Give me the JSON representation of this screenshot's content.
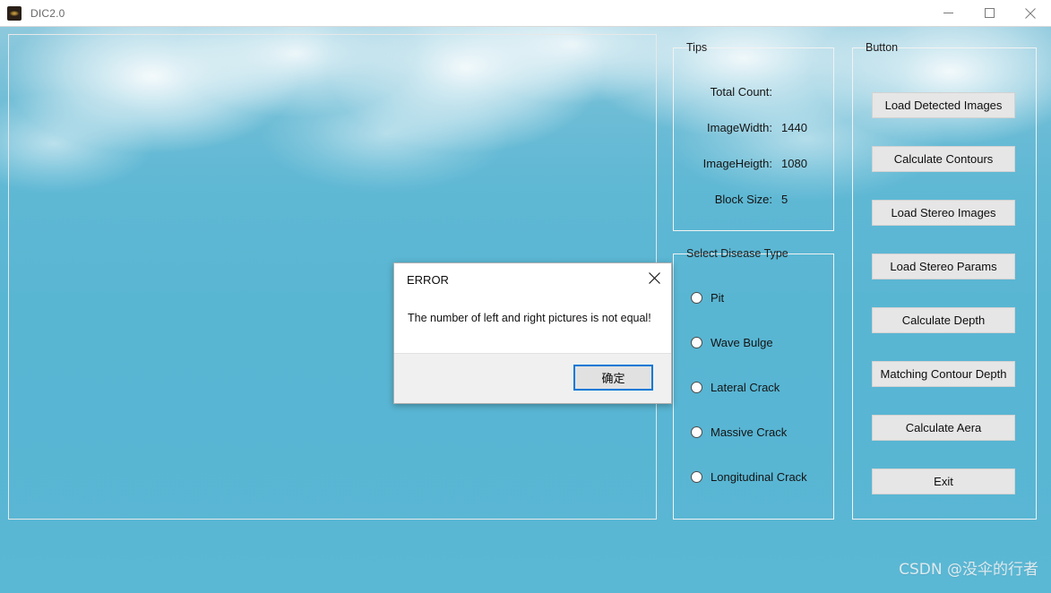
{
  "window": {
    "title": "DIC2.0",
    "icon": "app-image-icon",
    "controls": {
      "minimize": "minimize-icon",
      "maximize": "maximize-icon",
      "close": "close-icon"
    }
  },
  "tips": {
    "legend": "Tips",
    "rows": [
      {
        "label": "Total Count:",
        "value": ""
      },
      {
        "label": "ImageWidth:",
        "value": "1440"
      },
      {
        "label": "ImageHeigth:",
        "value": "1080"
      },
      {
        "label": "Block Size:",
        "value": "5"
      }
    ]
  },
  "disease": {
    "legend": "Select Disease Type",
    "options": [
      {
        "label": "Pit",
        "selected": false
      },
      {
        "label": "Wave Bulge",
        "selected": false
      },
      {
        "label": "Lateral Crack",
        "selected": false
      },
      {
        "label": "Massive Crack",
        "selected": false
      },
      {
        "label": "Longitudinal Crack",
        "selected": false
      }
    ]
  },
  "buttons": {
    "legend": "Button",
    "items": [
      {
        "label": "Load Detected Images"
      },
      {
        "label": "Calculate Contours"
      },
      {
        "label": "Load Stereo Images"
      },
      {
        "label": "Load Stereo Params"
      },
      {
        "label": "Calculate Depth"
      },
      {
        "label": "Matching Contour Depth"
      },
      {
        "label": "Calculate Aera"
      },
      {
        "label": "Exit"
      }
    ]
  },
  "dialog": {
    "title": "ERROR",
    "message": "The number of left and right pictures is not equal!",
    "ok_label": "确定",
    "close_icon": "close-icon",
    "focus_color": "#0078d7"
  },
  "watermark": {
    "text": "CSDN @没伞的行者"
  },
  "colors": {
    "background_teal": "#5bb8d4",
    "titlebar": "#ffffff",
    "button_face": "#e6e6e6",
    "accent_blue": "#0078d7"
  }
}
